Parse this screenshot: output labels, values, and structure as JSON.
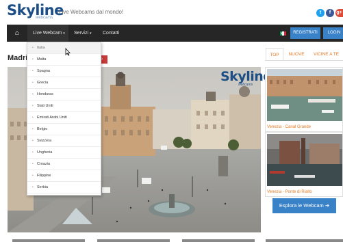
{
  "header": {
    "logo_text": "Skyline",
    "logo_sub": "webcams",
    "tagline": "Live Webcams dal mondo!",
    "social": [
      {
        "name": "twitter-icon",
        "glyph": "t",
        "color": "#1da1f2"
      },
      {
        "name": "facebook-icon",
        "glyph": "f",
        "color": "#3b5998"
      },
      {
        "name": "googleplus-icon",
        "glyph": "g+",
        "color": "#dd4b39"
      }
    ]
  },
  "nav": {
    "home_icon": "⌂",
    "items": [
      "Live Webcam",
      "Servizi",
      "Contatti"
    ],
    "register": "REGISTRATI",
    "login": "LOGIN",
    "language_caret": "▾"
  },
  "page": {
    "title": "Madri",
    "red_button": "›"
  },
  "dropdown": {
    "items": [
      "Italia",
      "Malta",
      "Spagna",
      "Grecia",
      "Honduras",
      "Stati Uniti",
      "Emirati Arabi Uniti",
      "Belgio",
      "Svizzera",
      "Ungheria",
      "Croazia",
      "Filippine",
      "Serbia"
    ]
  },
  "overlay": {
    "logo_text": "Skyline",
    "logo_sub": "webcams"
  },
  "sidebar": {
    "tabs": [
      "TOP",
      "NUOVE",
      "VICINE A TE"
    ],
    "cards": [
      {
        "caption": "Venezia - Canal Grande"
      },
      {
        "caption": "Venezia - Ponte di Rialto"
      }
    ],
    "explore_button": "Esplora le Webcam ➔"
  },
  "colors": {
    "brand_blue": "#1d4f86",
    "nav_bg": "#262626",
    "accent_orange": "#e57a22",
    "button_blue": "#3a82c8",
    "red": "#c73b3b"
  }
}
